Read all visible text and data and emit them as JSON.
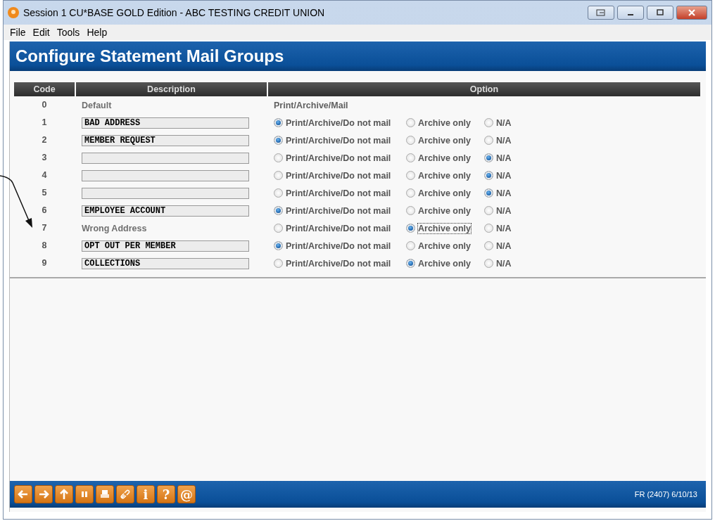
{
  "window": {
    "title": "Session 1 CU*BASE GOLD Edition - ABC TESTING CREDIT UNION"
  },
  "menu": [
    "File",
    "Edit",
    "Tools",
    "Help"
  ],
  "page_title": "Configure Statement Mail Groups",
  "table": {
    "columns": [
      "Code",
      "Description",
      "Option"
    ],
    "rows": [
      {
        "code": "0",
        "description": {
          "kind": "text",
          "value": "Default"
        },
        "option_text": "Print/Archive/Mail"
      },
      {
        "code": "1",
        "description": {
          "kind": "field",
          "value": "BAD ADDRESS"
        },
        "options": [
          {
            "label": "Print/Archive/Do not mail",
            "selected": true,
            "focused": false
          },
          {
            "label": "Archive only",
            "selected": false,
            "focused": false
          },
          {
            "label": "N/A",
            "selected": false,
            "focused": false
          }
        ]
      },
      {
        "code": "2",
        "description": {
          "kind": "field",
          "value": "MEMBER REQUEST"
        },
        "options": [
          {
            "label": "Print/Archive/Do not mail",
            "selected": true,
            "focused": false
          },
          {
            "label": "Archive only",
            "selected": false,
            "focused": false
          },
          {
            "label": "N/A",
            "selected": false,
            "focused": false
          }
        ]
      },
      {
        "code": "3",
        "description": {
          "kind": "field"
        },
        "options": [
          {
            "label": "Print/Archive/Do not mail",
            "selected": false,
            "focused": false
          },
          {
            "label": "Archive only",
            "selected": false,
            "focused": false
          },
          {
            "label": "N/A",
            "selected": true,
            "focused": false
          }
        ]
      },
      {
        "code": "4",
        "description": {
          "kind": "field"
        },
        "options": [
          {
            "label": "Print/Archive/Do not mail",
            "selected": false,
            "focused": false
          },
          {
            "label": "Archive only",
            "selected": false,
            "focused": false
          },
          {
            "label": "N/A",
            "selected": true,
            "focused": false
          }
        ]
      },
      {
        "code": "5",
        "description": {
          "kind": "field"
        },
        "options": [
          {
            "label": "Print/Archive/Do not mail",
            "selected": false,
            "focused": false
          },
          {
            "label": "Archive only",
            "selected": false,
            "focused": false
          },
          {
            "label": "N/A",
            "selected": true,
            "focused": false
          }
        ]
      },
      {
        "code": "6",
        "description": {
          "kind": "field",
          "value": "EMPLOYEE ACCOUNT"
        },
        "options": [
          {
            "label": "Print/Archive/Do not mail",
            "selected": true,
            "focused": false
          },
          {
            "label": "Archive only",
            "selected": false,
            "focused": false
          },
          {
            "label": "N/A",
            "selected": false,
            "focused": false
          }
        ]
      },
      {
        "code": "7",
        "description": {
          "kind": "text",
          "value": "Wrong Address"
        },
        "options": [
          {
            "label": "Print/Archive/Do not mail",
            "selected": false,
            "focused": false
          },
          {
            "label": "Archive only",
            "selected": true,
            "focused": true
          },
          {
            "label": "N/A",
            "selected": false,
            "focused": false
          }
        ]
      },
      {
        "code": "8",
        "description": {
          "kind": "field",
          "value": "OPT OUT PER MEMBER"
        },
        "options": [
          {
            "label": "Print/Archive/Do not mail",
            "selected": true,
            "focused": false
          },
          {
            "label": "Archive only",
            "selected": false,
            "focused": false
          },
          {
            "label": "N/A",
            "selected": false,
            "focused": false
          }
        ]
      },
      {
        "code": "9",
        "description": {
          "kind": "field",
          "value": "COLLECTIONS"
        },
        "options": [
          {
            "label": "Print/Archive/Do not mail",
            "selected": false,
            "focused": false
          },
          {
            "label": "Archive only",
            "selected": true,
            "focused": false
          },
          {
            "label": "N/A",
            "selected": false,
            "focused": false
          }
        ]
      }
    ]
  },
  "toolbar": [
    {
      "kind": "back"
    },
    {
      "kind": "forward"
    },
    {
      "kind": "up"
    },
    {
      "kind": "pause"
    },
    {
      "kind": "print"
    },
    {
      "kind": "link"
    },
    {
      "kind": "text",
      "label": "i"
    },
    {
      "kind": "text",
      "label": "?"
    },
    {
      "kind": "text",
      "label": "@"
    }
  ],
  "status": "FR (2407) 6/10/13"
}
